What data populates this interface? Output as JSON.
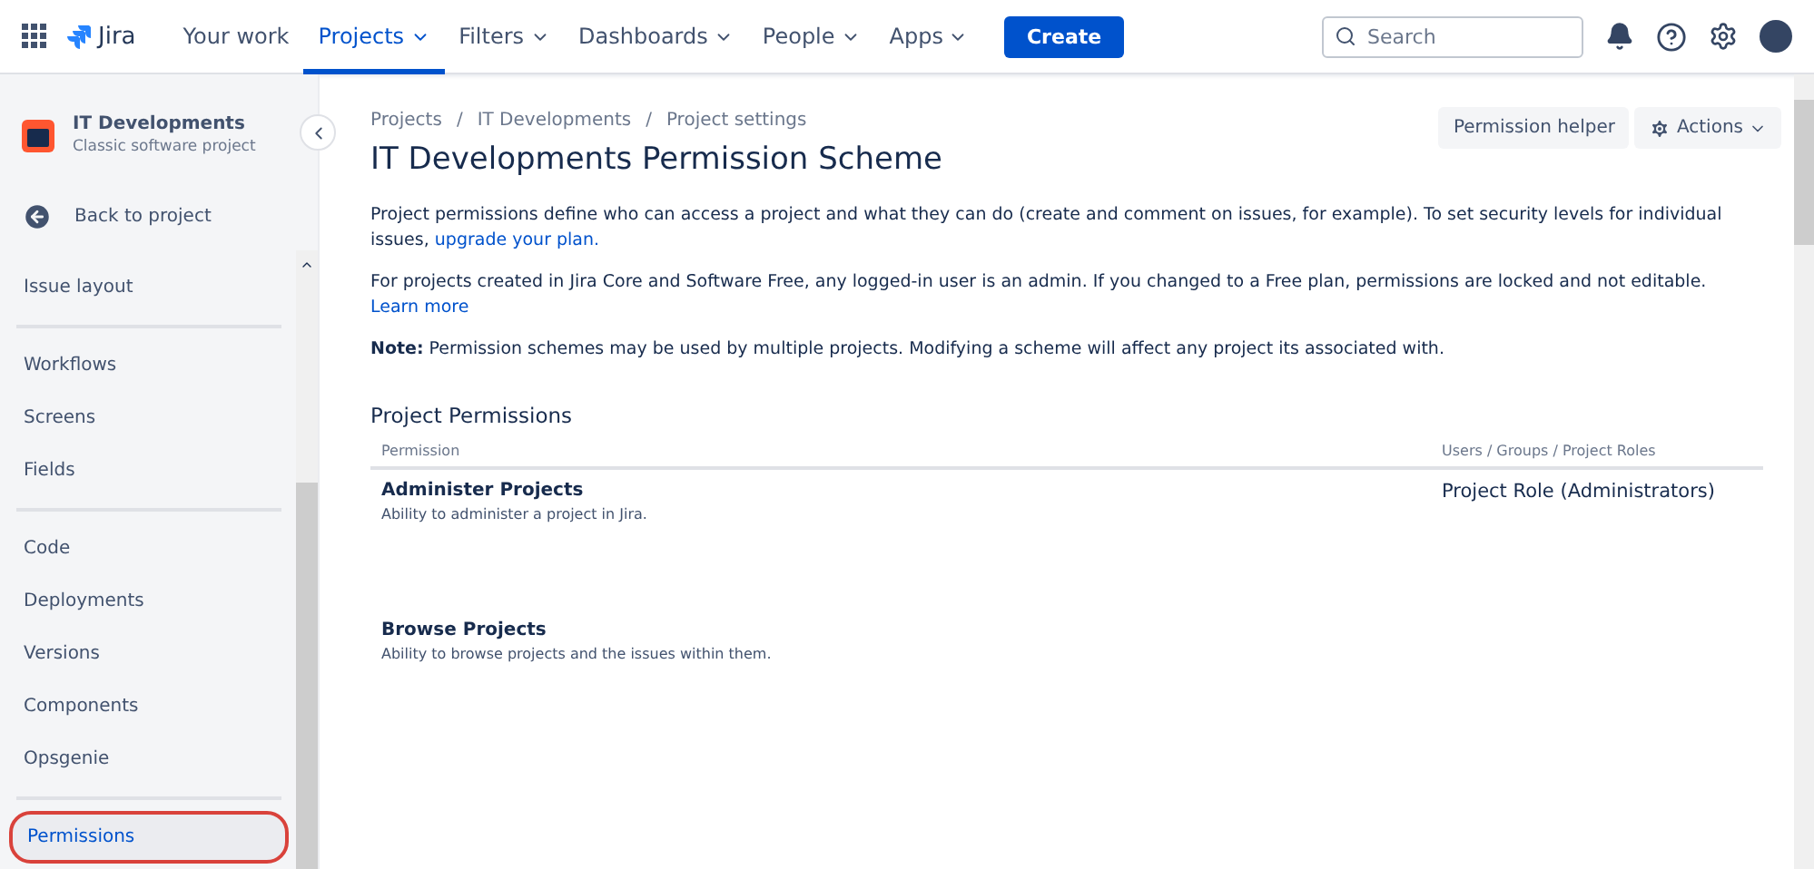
{
  "nav": {
    "product": "Jira",
    "items": [
      {
        "label": "Your work",
        "selected": false,
        "dropdown": false
      },
      {
        "label": "Projects",
        "selected": true,
        "dropdown": true
      },
      {
        "label": "Filters",
        "selected": false,
        "dropdown": true
      },
      {
        "label": "Dashboards",
        "selected": false,
        "dropdown": true
      },
      {
        "label": "People",
        "selected": false,
        "dropdown": true
      },
      {
        "label": "Apps",
        "selected": false,
        "dropdown": true
      }
    ],
    "create": "Create",
    "search": {
      "placeholder": "Search"
    }
  },
  "sidebar": {
    "project": {
      "name": "IT Developments",
      "type": "Classic software project"
    },
    "back": "Back to project",
    "groups": [
      [
        "Issue layout"
      ],
      [
        "Workflows",
        "Screens",
        "Fields"
      ],
      [
        "Code",
        "Deployments",
        "Versions",
        "Components",
        "Opsgenie"
      ]
    ],
    "items_selected": [
      {
        "label": "Permissions",
        "selected": true,
        "annotated": true
      }
    ]
  },
  "breadcrumbs": [
    {
      "label": "Projects"
    },
    {
      "separator": "/",
      "label": "IT Developments"
    },
    {
      "separator": "/",
      "label": "Project settings"
    }
  ],
  "actions": {
    "helper": "Permission helper",
    "menu": "Actions"
  },
  "title": "IT Developments Permission Scheme",
  "paragraphs": [
    {
      "text": "Project permissions define who can access a project and what they can do (create and comment on issues, for example). To set security levels for individual issues,",
      "link": "upgrade your plan."
    },
    {
      "text": "For projects created in Jira Core and Software Free, any logged-in user is an admin. If you changed to a Free plan, permissions are locked and not editable.",
      "link": "Learn more"
    },
    {
      "text": "**Note:** Permission schemes may be used by multiple projects. Modifying a scheme will affect any project its associated with."
    }
  ],
  "section": "Project Permissions",
  "table": {
    "columns": [
      "Permission",
      "Users / Groups / Project Roles"
    ],
    "rows": [
      {
        "name": "Administer Projects",
        "description": "Ability to administer a project in Jira.",
        "grantee": "Project Role (Administrators)"
      },
      {
        "name": "Browse Projects",
        "description": "Ability to browse projects and the issues within them."
      }
    ]
  }
}
